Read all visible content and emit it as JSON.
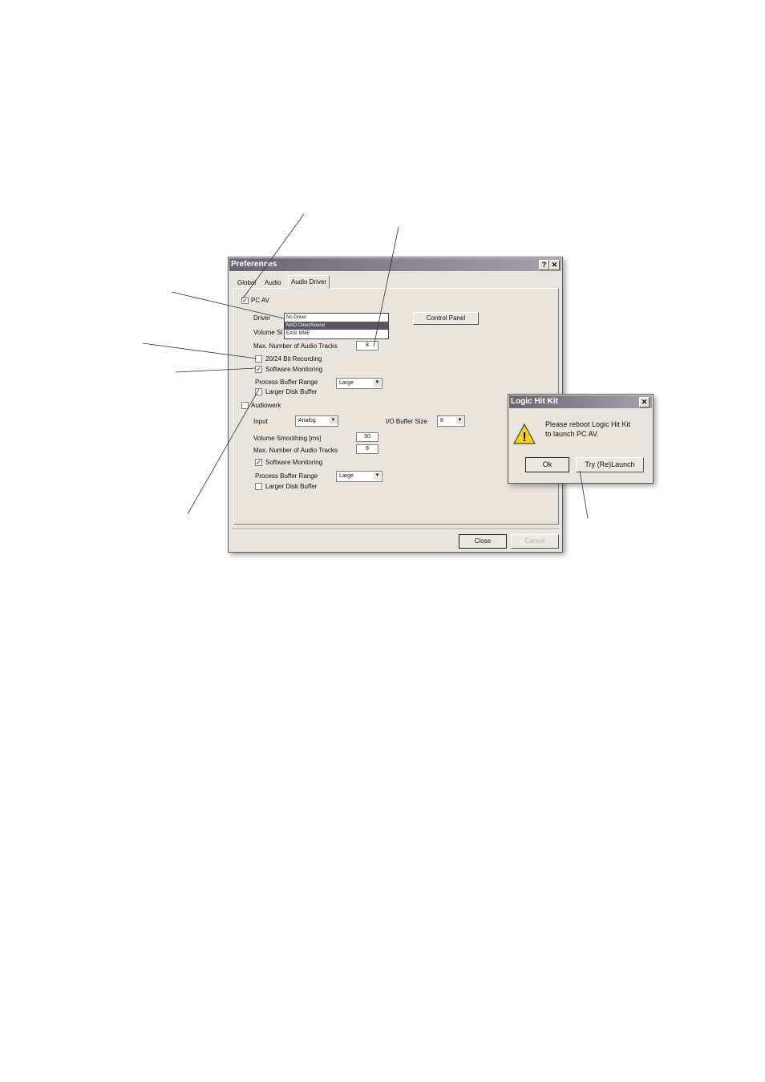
{
  "prefs": {
    "title": "Preferences",
    "help_btn": "?",
    "close_btn": "✕",
    "tabs": [
      "Global",
      "Audio",
      "Audio Driver"
    ],
    "pcav": {
      "label": "PC AV",
      "checked": true,
      "driver_label": "Driver",
      "driver_options": [
        "No Driver",
        "MAD DirectSound",
        "EASI MME"
      ],
      "volume_label": "Volume Sl",
      "max_tracks_label": "Max. Number of Audio Tracks",
      "max_tracks_value": "8",
      "control_panel": "Control Panel",
      "rec2024_label": "20/24 Bit Recording",
      "rec2024_checked": false,
      "monitoring_label": "Software Monitoring",
      "monitoring_checked": true,
      "buffer_range_label": "Process Buffer Range",
      "buffer_range_value": "Large",
      "disk_buffer_label": "Larger Disk Buffer",
      "disk_buffer_checked": false
    },
    "audiowerk": {
      "label": "Audiowerk",
      "checked": false,
      "input_label": "Input",
      "input_value": "Analog",
      "io_buffer_label": "I/O Buffer Size",
      "io_buffer_value": "8",
      "volume_smoothing_label": "Volume Smoothing [ms]",
      "volume_smoothing_value": "50",
      "max_tracks_label": "Max. Number of Audio Tracks",
      "max_tracks_value": "8",
      "monitoring_label": "Software Monitoring",
      "monitoring_checked": true,
      "buffer_range_label": "Process Buffer Range",
      "buffer_range_value": "Large",
      "disk_buffer_label": "Larger Disk Buffer",
      "disk_buffer_checked": false
    },
    "close_button": "Close",
    "cancel_button": "Cancel"
  },
  "alert": {
    "title": "Logic Hit Kit",
    "close_btn": "✕",
    "message_line1": "Please reboot Logic Hit Kit",
    "message_line2": "to launch PC AV.",
    "ok_button": "Ok",
    "relaunch_button": "Try (Re)Launch",
    "warning_icon_glyph": "!"
  },
  "colors": {
    "window_bg": "#e9e4dc",
    "title_gradient_start": "#6a6470",
    "selection": "#5a5463",
    "warning_yellow": "#f2d21b"
  },
  "checkmark_glyph": "✓",
  "dropdown_arrow_glyph": "▼"
}
